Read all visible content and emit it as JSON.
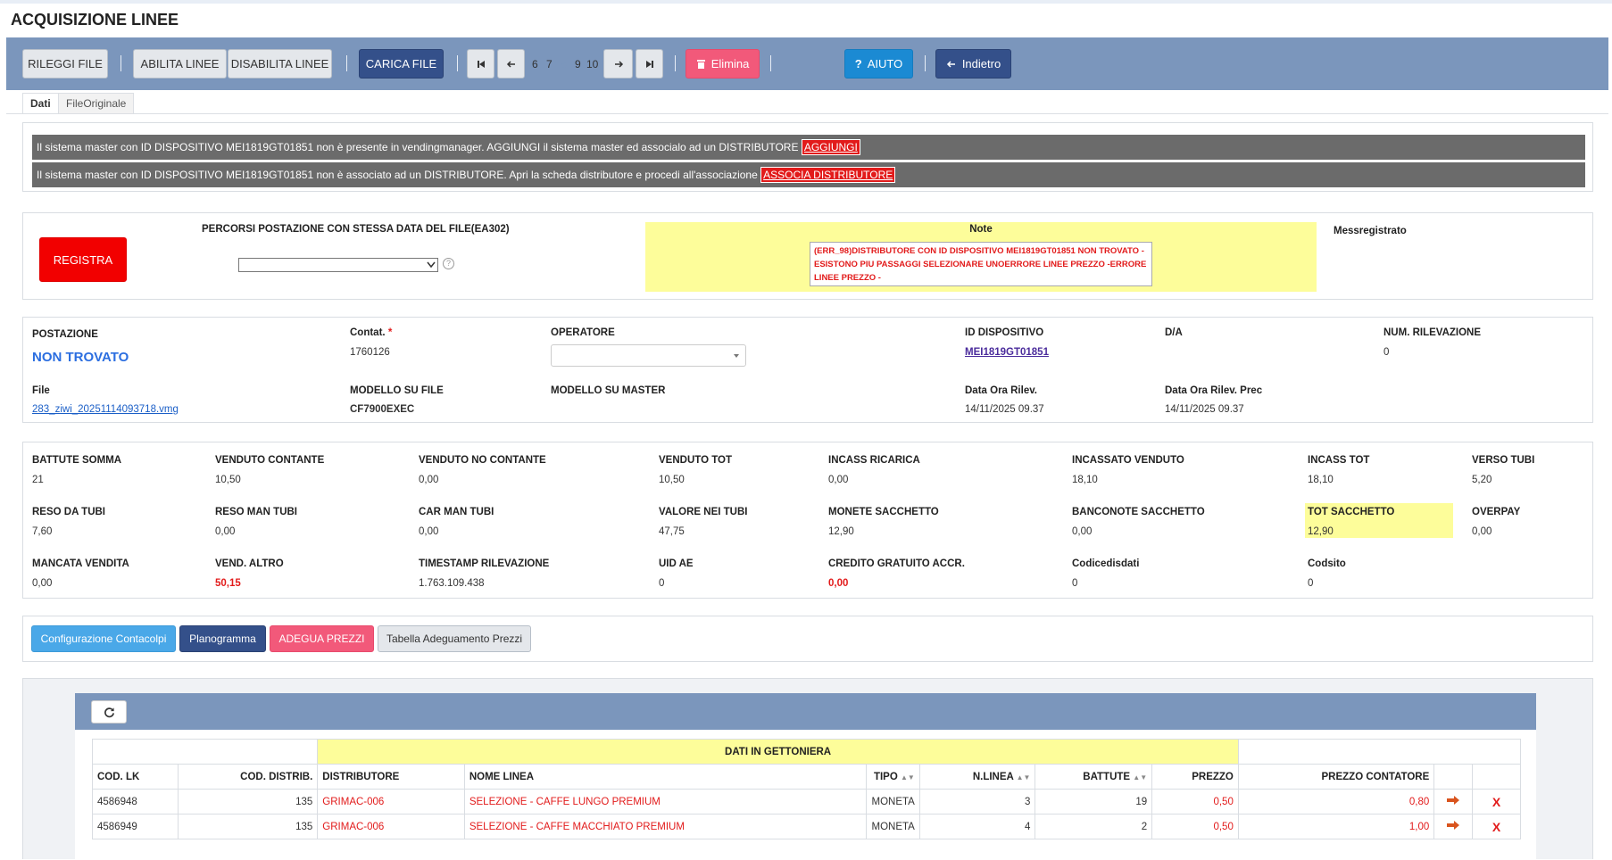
{
  "page": {
    "title": "ACQUISIZIONE LINEE"
  },
  "toolbar": {
    "rileggi": "RILEGGI FILE",
    "abilita": "ABILITA LINEE",
    "disabilita": "DISABILITA LINEE",
    "carica": "CARICA FILE",
    "pages": [
      "6",
      "7",
      "8",
      "9",
      "10"
    ],
    "current_page": "8",
    "elimina": "Elimina",
    "aiuto": "AIUTO",
    "indietro": "Indietro"
  },
  "tabs": {
    "dati": "Dati",
    "file_originale": "FileOriginale"
  },
  "alerts": [
    {
      "text": "Il sistema master con ID DISPOSITIVO MEI1819GT01851 non è presente in vendingmanager. AGGIUNGI il sistema master ed associalo ad un DISTRIBUTORE",
      "link": "AGGIUNGI"
    },
    {
      "text": "Il sistema master con ID DISPOSITIVO MEI1819GT01851 non è associato ad un DISTRIBUTORE. Apri la scheda distributore e procedi all'associazione",
      "link": "ASSOCIA DISTRIBUTORE"
    }
  ],
  "registra": {
    "button": "REGISTRA",
    "percorsi_label": "PERCORSI POSTAZIONE CON STESSA DATA DEL FILE(EA302)",
    "percorsi_value": "",
    "help": "?",
    "note_label": "Note",
    "note_text": "(ERR_98)DISTRIBUTORE CON ID DISPOSITIVO MEI1819GT01851 NON TROVATO - ESISTONO PIU PASSAGGI SELEZIONARE UNOERRORE LINEE PREZZO -ERRORE LINEE PREZZO -",
    "messregistrato_label": "Messregistrato"
  },
  "info": {
    "postazione_label": "POSTAZIONE",
    "postazione_value": "NON TROVATO",
    "contat_label": "Contat.",
    "contat_required": "*",
    "contat_value": "1760126",
    "operatore_label": "OPERATORE",
    "operatore_value": "",
    "id_dispositivo_label": "ID DISPOSITIVO",
    "id_dispositivo_value": "MEI1819GT01851",
    "da_label": "D/A",
    "num_rilevazione_label": "NUM. RILEVAZIONE",
    "num_rilevazione_value": "0",
    "file_label": "File",
    "file_value": "283_ziwi_20251114093718.vmg",
    "modello_file_label": "MODELLO SU FILE",
    "modello_file_value": "CF7900EXEC",
    "modello_master_label": "MODELLO SU MASTER",
    "data_ora_label": "Data Ora Rilev.",
    "data_ora_value": "14/11/2025 09.37",
    "data_ora_prec_label": "Data Ora Rilev. Prec",
    "data_ora_prec_value": "14/11/2025 09.37"
  },
  "stats": {
    "row1": [
      {
        "label": "BATTUTE SOMMA",
        "value": "21"
      },
      {
        "label": "VENDUTO CONTANTE",
        "value": "10,50"
      },
      {
        "label": "VENDUTO NO CONTANTE",
        "value": "0,00"
      },
      {
        "label": "VENDUTO TOT",
        "value": "10,50"
      },
      {
        "label": "INCASS RICARICA",
        "value": "0,00"
      },
      {
        "label": "INCASSATO VENDUTO",
        "value": "18,10"
      },
      {
        "label": "INCASS TOT",
        "value": "18,10"
      },
      {
        "label": "VERSO TUBI",
        "value": "5,20"
      }
    ],
    "row2": [
      {
        "label": "RESO DA TUBI",
        "value": "7,60"
      },
      {
        "label": "RESO MAN TUBI",
        "value": "0,00"
      },
      {
        "label": "CAR MAN TUBI",
        "value": "0,00"
      },
      {
        "label": "VALORE NEI TUBI",
        "value": "47,75"
      },
      {
        "label": "MONETE SACCHETTO",
        "value": "12,90"
      },
      {
        "label": "BANCONOTE SACCHETTO",
        "value": "0,00"
      },
      {
        "label": "TOT SACCHETTO",
        "value": "12,90"
      },
      {
        "label": "OVERPAY",
        "value": "0,00"
      }
    ],
    "row3": [
      {
        "label": "MANCATA VENDITA",
        "value": "0,00"
      },
      {
        "label": "VEND. ALTRO",
        "value": "50,15"
      },
      {
        "label": "TIMESTAMP RILEVAZIONE",
        "value": "1.763.109.438"
      },
      {
        "label": "UID AE",
        "value": "0"
      },
      {
        "label": "CREDITO GRATUITO ACCR.",
        "value": "0,00"
      },
      {
        "label": "Codicedisdati",
        "value": "0"
      },
      {
        "label": "Codsito",
        "value": "0"
      }
    ]
  },
  "actions": {
    "configurazione": "Configurazione Contacolpi",
    "planogramma": "Planogramma",
    "adegua": "ADEGUA PREZZI",
    "tabella": "Tabella Adeguamento Prezzi"
  },
  "table": {
    "group_header": "DATI IN GETTONIERA",
    "columns": [
      "COD. LK",
      "COD. DISTRIB.",
      "DISTRIBUTORE",
      "NOME LINEA",
      "TIPO",
      "N.LINEA",
      "BATTUTE",
      "PREZZO",
      "PREZZO CONTATORE"
    ],
    "rows": [
      {
        "cod_lk": "4586948",
        "cod_distrib": "135",
        "distributore": "GRIMAC-006",
        "nome_linea": "SELEZIONE - CAFFE LUNGO PREMIUM",
        "tipo": "MONETA",
        "n_linea": "3",
        "battute": "19",
        "prezzo": "0,50",
        "prezzo_contatore": "0,80",
        "delete": "X"
      },
      {
        "cod_lk": "4586949",
        "cod_distrib": "135",
        "distributore": "GRIMAC-006",
        "nome_linea": "SELEZIONE - CAFFE MACCHIATO PREMIUM",
        "tipo": "MONETA",
        "n_linea": "4",
        "battute": "2",
        "prezzo": "0,50",
        "prezzo_contatore": "1,00",
        "delete": "X"
      }
    ]
  }
}
